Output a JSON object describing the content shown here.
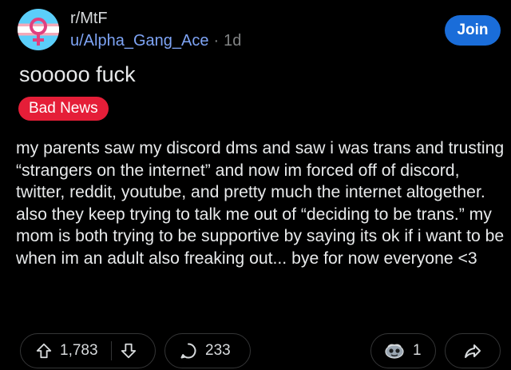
{
  "post": {
    "subreddit": "r/MtF",
    "username": "u/Alpha_Gang_Ace",
    "separator": "·",
    "age": "1d",
    "join_label": "Join",
    "title": "sooooo fuck",
    "flair": "Bad News",
    "body": "my parents saw my discord dms and saw i was trans and trusting “strangers on the internet” and now im forced off of discord, twitter, reddit, youtube, and pretty much the internet altogether.  also they keep trying to talk me out of “deciding to be trans.”  my mom is both trying to be supportive by saying its ok if i want to be when im an adult also freaking out... bye for now everyone <3"
  },
  "actions": {
    "upvotes": "1,783",
    "comments": "233",
    "awards": "1"
  },
  "icons": {
    "avatar": "trans-female-symbol-icon",
    "upvote": "arrow-up-icon",
    "downvote": "arrow-down-icon",
    "comment": "speech-bubble-icon",
    "award": "award-icon",
    "share": "share-arrow-icon"
  },
  "colors": {
    "background": "#000000",
    "join_button": "#1a6dd9",
    "flair_background": "#e51e38",
    "username": "#7ea4f5",
    "trans_blue": "#5bcefa",
    "trans_pink": "#f5a9b8"
  }
}
